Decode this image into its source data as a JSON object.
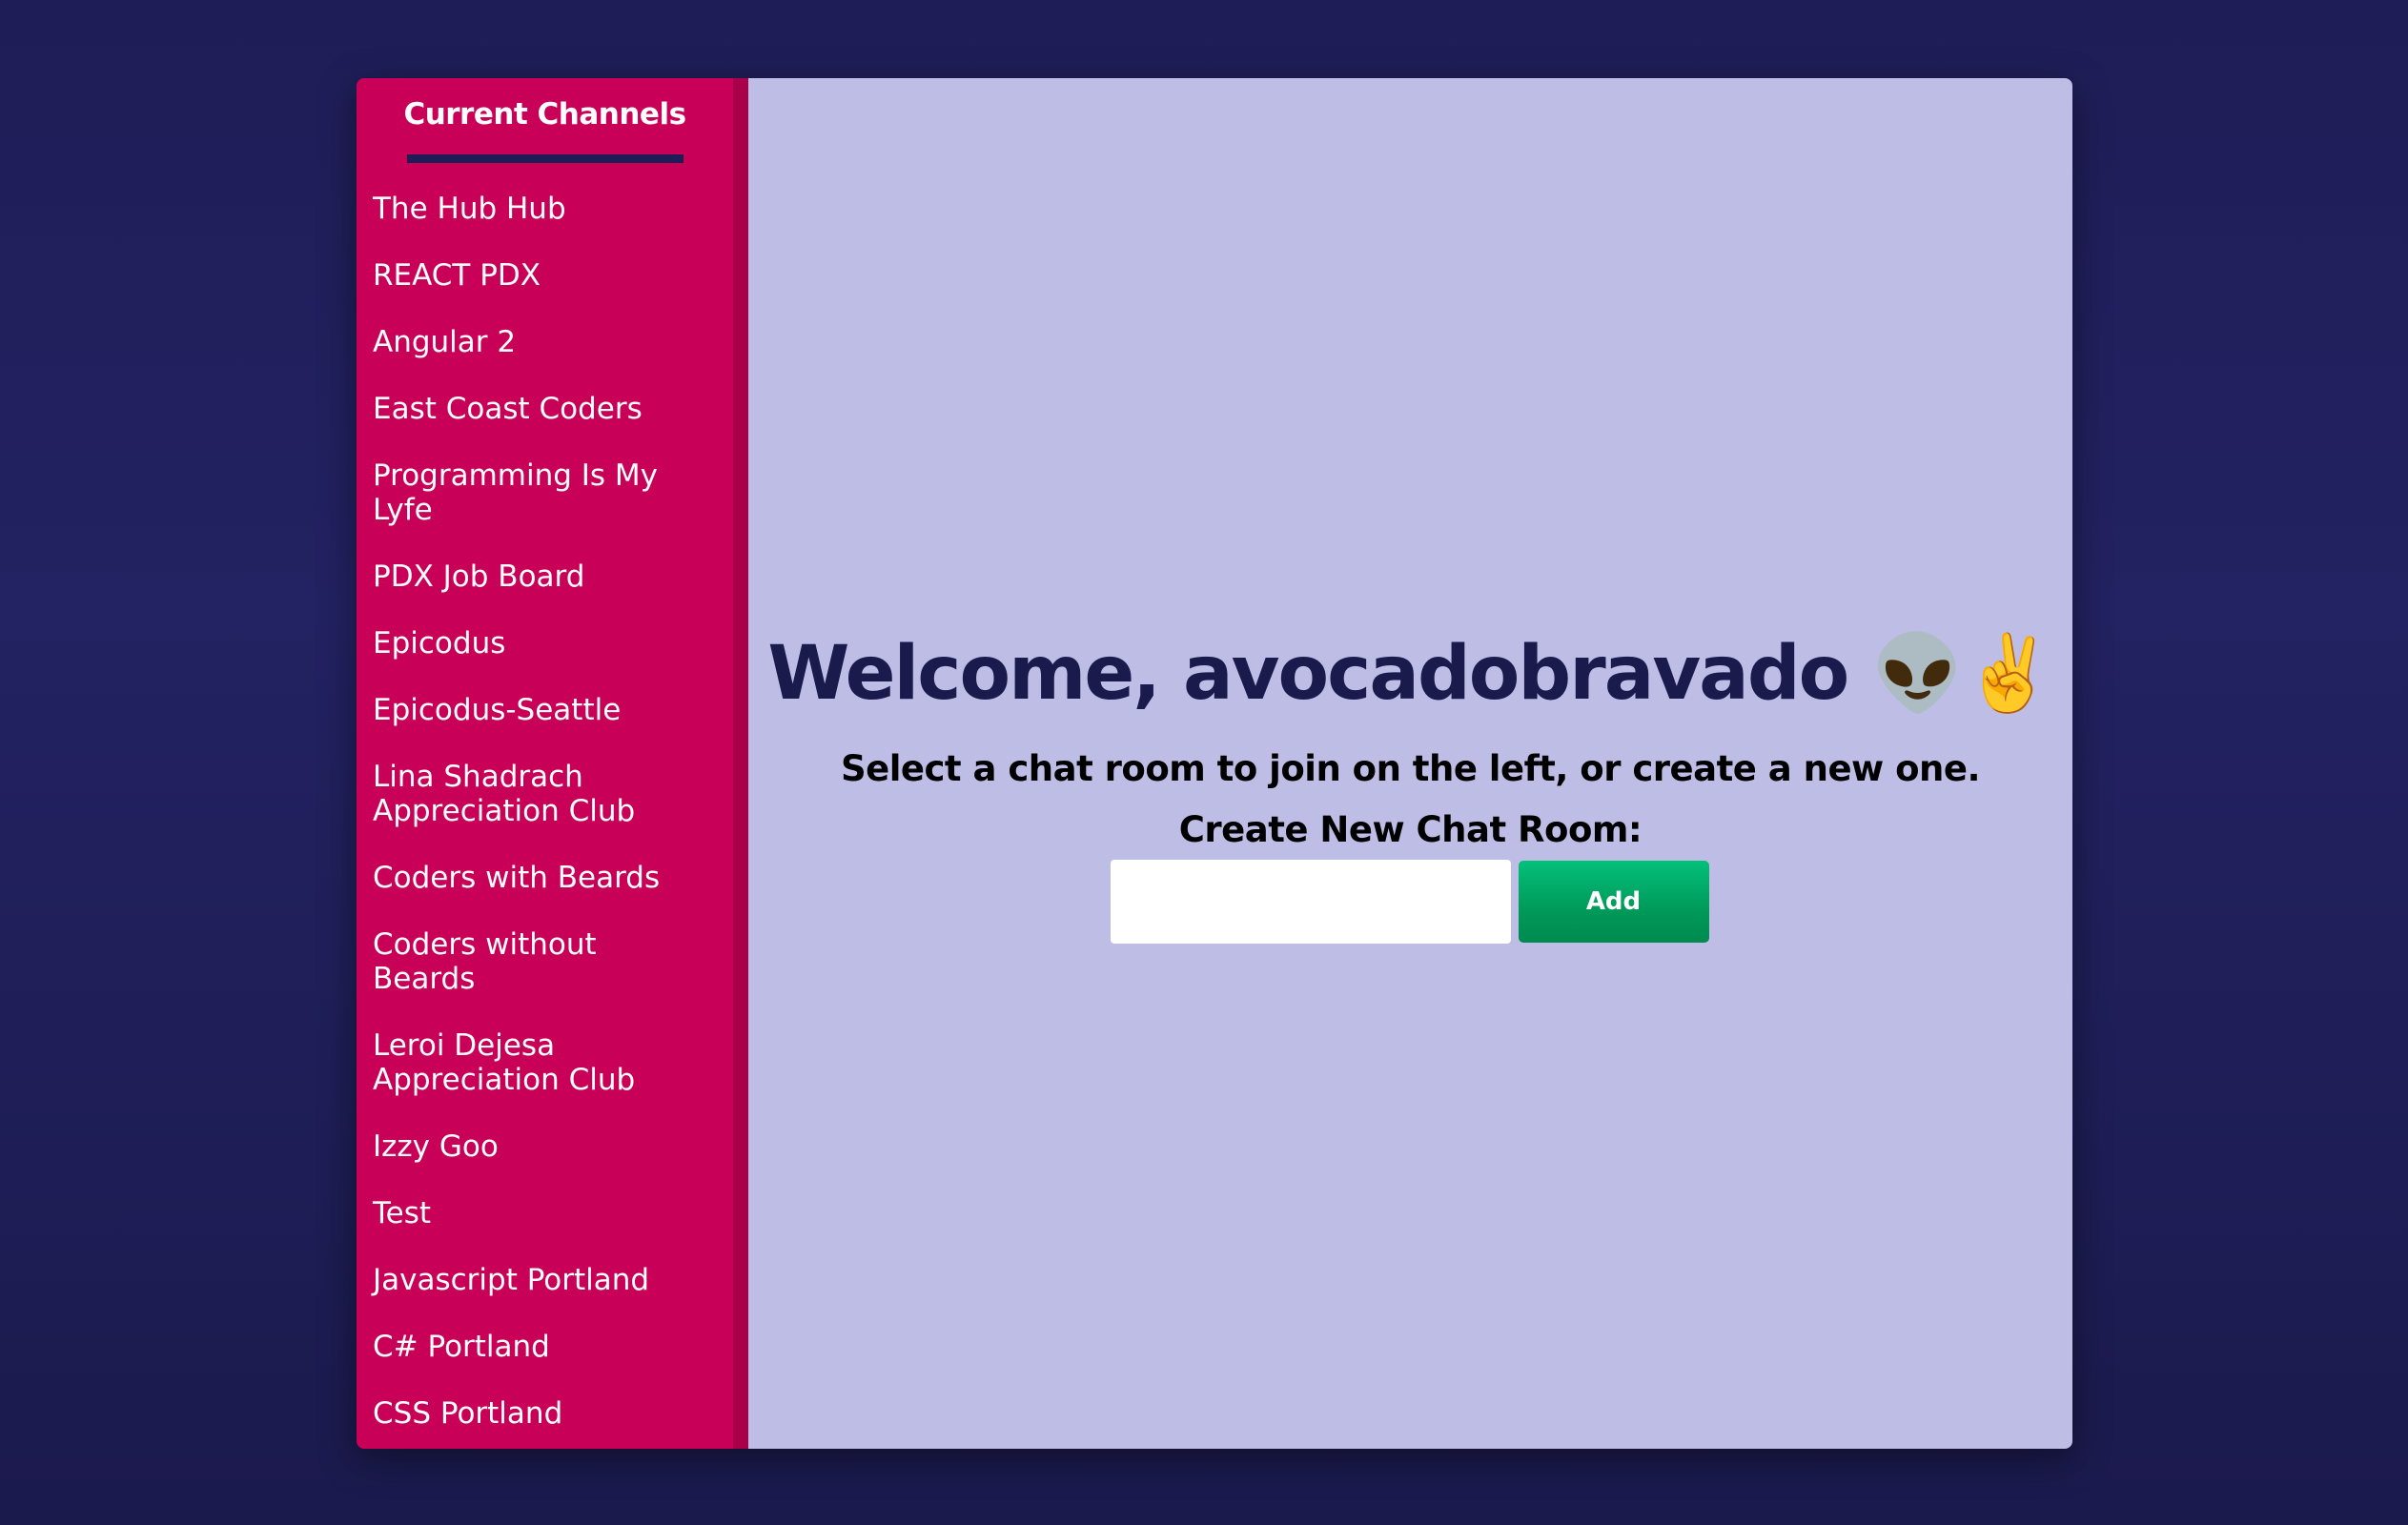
{
  "sidebar": {
    "title": "Current Channels",
    "channels": [
      "The Hub Hub",
      "REACT PDX",
      "Angular 2",
      "East Coast Coders",
      "Programming Is My Lyfe",
      "PDX Job Board",
      "Epicodus",
      "Epicodus-Seattle",
      "Lina Shadrach Appreciation Club",
      "Coders with Beards",
      "Coders without Beards",
      "Leroi Dejesa Appreciation Club",
      "Izzy Goo",
      "Test",
      "Javascript Portland",
      "C# Portland",
      "CSS Portland"
    ]
  },
  "main": {
    "welcome": "Welcome, avocadobravado 👽✌️",
    "subtitle": "Select a chat room to join on the left, or create a new one.",
    "create_label": "Create New Chat Room:",
    "room_input_value": "",
    "add_label": "Add"
  },
  "colors": {
    "background": "#1f1d57",
    "sidebar": "#c80057",
    "main_panel": "#bdbde6",
    "accent": "#02a862"
  }
}
